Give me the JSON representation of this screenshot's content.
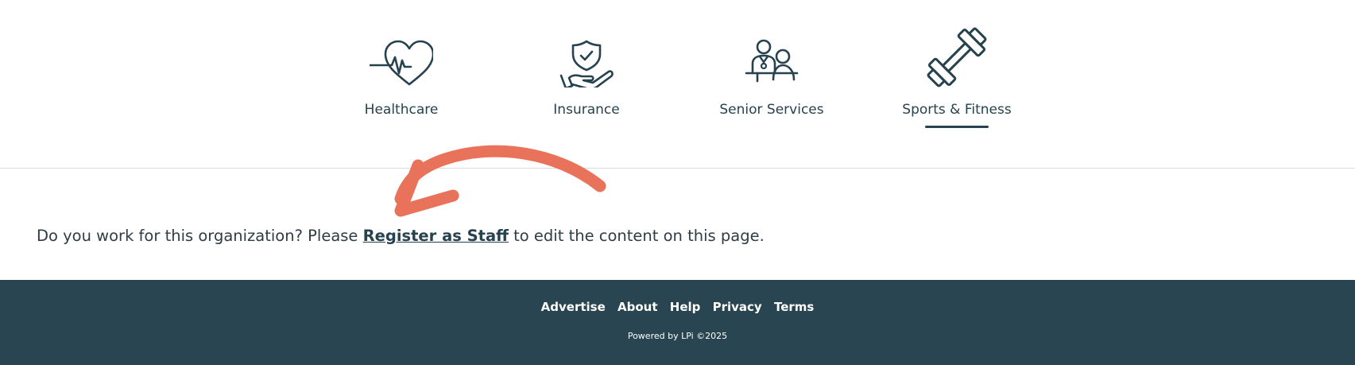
{
  "categories": [
    {
      "label": "Healthcare",
      "icon": "heart-pulse-icon"
    },
    {
      "label": "Insurance",
      "icon": "shield-hand-icon"
    },
    {
      "label": "Senior Services",
      "icon": "people-icon"
    },
    {
      "label": "Sports & Fitness",
      "icon": "dumbbell-icon",
      "active": true
    }
  ],
  "staff_prompt": {
    "before": "Do you work for this organization? Please ",
    "link": "Register as Staff",
    "after": " to edit the content on this page."
  },
  "footer": {
    "links": [
      "Advertise",
      "About",
      "Help",
      "Privacy",
      "Terms"
    ],
    "powered_by": "Powered by LPi ©2025"
  },
  "colors": {
    "primary": "#26424f",
    "footer_bg": "#284551",
    "arrow": "#e8735a"
  }
}
